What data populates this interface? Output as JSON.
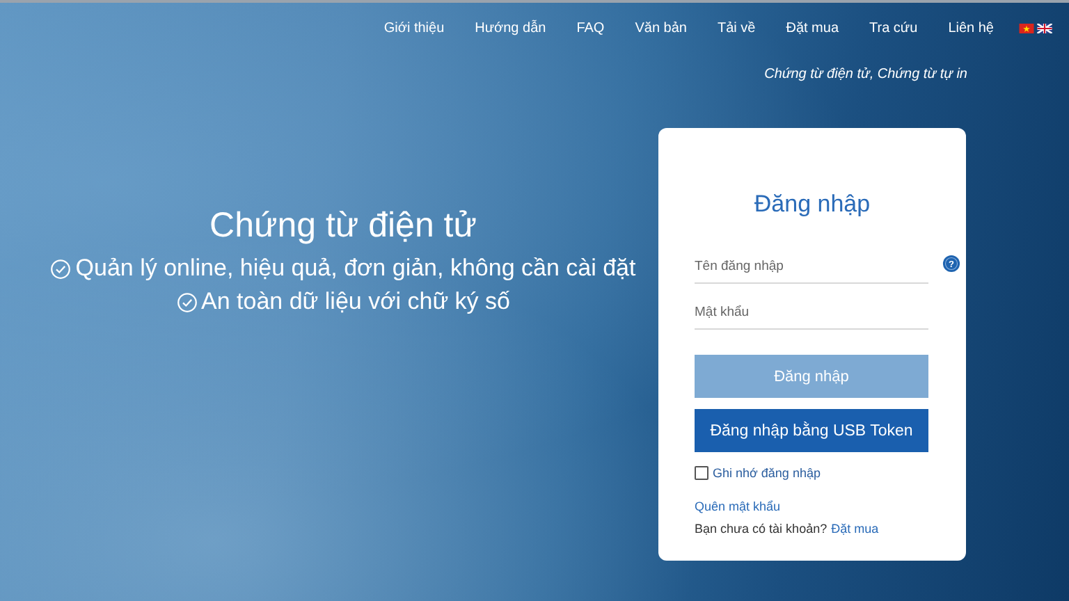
{
  "nav": {
    "items": [
      "Giới thiệu",
      "Hướng dẫn",
      "FAQ",
      "Văn bản",
      "Tải về",
      "Đặt mua",
      "Tra cứu",
      "Liên hệ"
    ],
    "languages": [
      {
        "kind": "vn"
      },
      {
        "kind": "uk"
      }
    ]
  },
  "tagline": "Chứng từ điện tử, Chứng từ tự in",
  "hero": {
    "title": "Chứng từ điện tử",
    "features": [
      "Quản lý online, hiệu quả, đơn giản, không cần cài đặt",
      "An toàn dữ liệu với chữ ký số"
    ]
  },
  "login": {
    "title": "Đăng nhập",
    "username": {
      "placeholder": "Tên đăng nhập"
    },
    "help": "?",
    "password": {
      "placeholder": "Mật khẩu"
    },
    "submit": {
      "label": "Đăng nhập",
      "disabled": true
    },
    "usb_button": "Đăng nhập bằng USB Token",
    "remember": {
      "label": "Ghi nhớ đăng nhập",
      "checked": false
    },
    "forgot": "Quên mật khẩu",
    "signup_prompt": "Bạn chưa có tài khoản?",
    "signup_link": "Đặt mua"
  }
}
